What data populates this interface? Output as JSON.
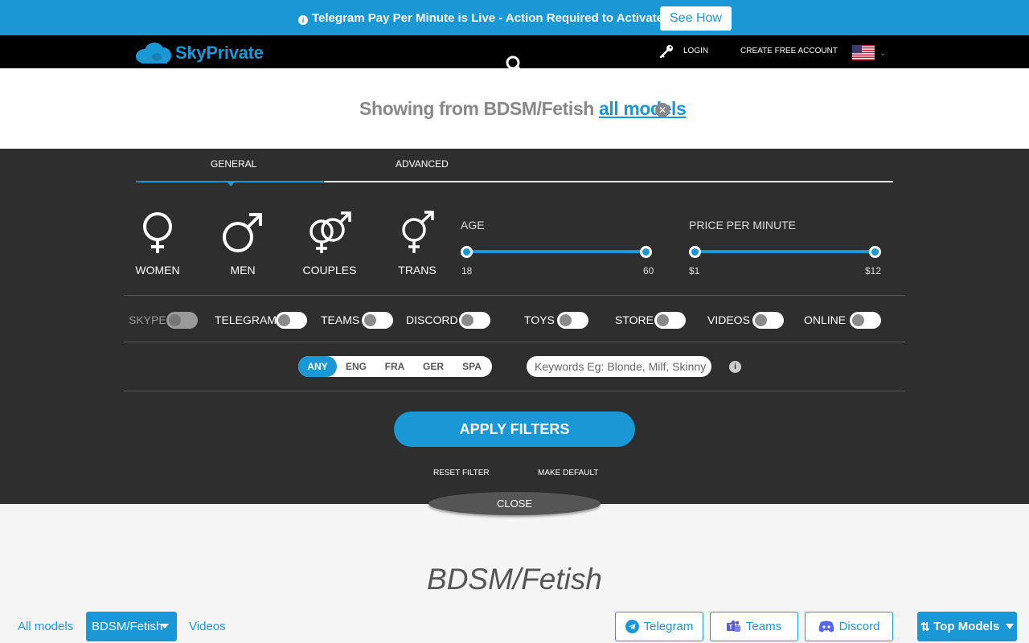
{
  "announcement": {
    "message": "Telegram Pay Per Minute is Live - Action Required to Activate",
    "button": "See How"
  },
  "nav": {
    "logo_text": "SkyPrivate",
    "login": "LOGIN",
    "create_account": "CREATE FREE ACCOUNT",
    "language_flag": "us-flag-icon"
  },
  "showing": {
    "prefix": "Showing from BDSM/Fetish",
    "link": "all models"
  },
  "filters": {
    "tabs": [
      "GENERAL",
      "ADVANCED"
    ],
    "active_tab": "GENERAL",
    "genders": [
      "WOMEN",
      "MEN",
      "COUPLES",
      "TRANS"
    ],
    "age": {
      "label": "AGE",
      "min_label": "18",
      "max_label": "60",
      "min": 18,
      "max": 60
    },
    "price": {
      "label": "PRICE PER MINUTE",
      "min_label": "$1",
      "max_label": "$12",
      "min": 1,
      "max": 12
    },
    "toggles": [
      {
        "label": "SKYPE",
        "on": false,
        "disabled": true
      },
      {
        "label": "TELEGRAM",
        "on": false,
        "disabled": false
      },
      {
        "label": "TEAMS",
        "on": false,
        "disabled": false
      },
      {
        "label": "DISCORD",
        "on": false,
        "disabled": false
      },
      {
        "label": "TOYS",
        "on": false,
        "disabled": false
      },
      {
        "label": "STORE",
        "on": false,
        "disabled": false
      },
      {
        "label": "VIDEOS",
        "on": false,
        "disabled": false
      },
      {
        "label": "ONLINE",
        "on": false,
        "disabled": false
      }
    ],
    "languages": [
      "ANY",
      "ENG",
      "FRA",
      "GER",
      "SPA"
    ],
    "active_language": "ANY",
    "keywords_placeholder": "Keywords Eg: Blonde, Milf, Skinny",
    "keywords_value": "",
    "apply": "APPLY FILTERS",
    "reset": "RESET FILTER",
    "make_default": "MAKE DEFAULT",
    "close": "CLOSE"
  },
  "page": {
    "title": "BDSM/Fetish"
  },
  "bottom_bar": {
    "all_models": "All models",
    "category": "BDSM/Fetish",
    "videos": "Videos",
    "telegram": "Telegram",
    "teams": "Teams",
    "discord": "Discord",
    "sort": "Top Models"
  },
  "colors": {
    "accent": "#1a98d6",
    "panel_bg": "#2e2e2e",
    "nav_bg": "#000000"
  }
}
